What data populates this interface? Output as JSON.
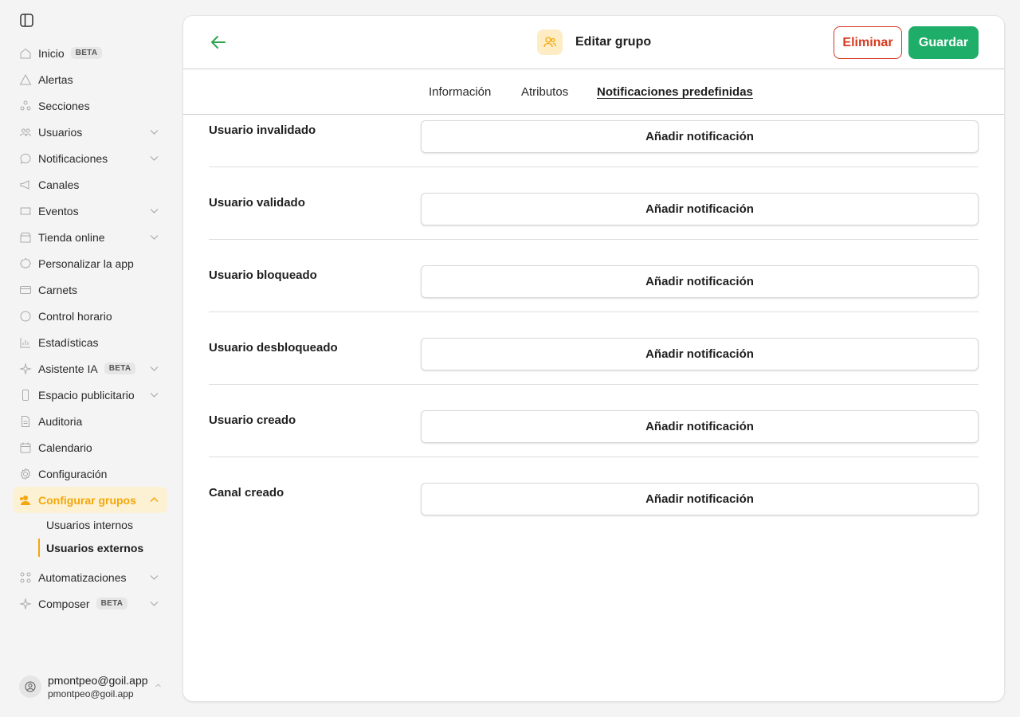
{
  "sidebar": {
    "items": [
      {
        "label": "Inicio",
        "icon": "home-icon",
        "badge": "BETA",
        "chevron": false
      },
      {
        "label": "Alertas",
        "icon": "alert-icon",
        "chevron": false
      },
      {
        "label": "Secciones",
        "icon": "sections-icon",
        "chevron": false
      },
      {
        "label": "Usuarios",
        "icon": "users-icon",
        "chevron": true
      },
      {
        "label": "Notificaciones",
        "icon": "chat-icon",
        "chevron": true
      },
      {
        "label": "Canales",
        "icon": "megaphone-icon",
        "chevron": false
      },
      {
        "label": "Eventos",
        "icon": "ticket-icon",
        "chevron": true
      },
      {
        "label": "Tienda online",
        "icon": "store-icon",
        "chevron": true
      },
      {
        "label": "Personalizar la app",
        "icon": "badge-icon",
        "chevron": false
      },
      {
        "label": "Carnets",
        "icon": "card-icon",
        "chevron": false
      },
      {
        "label": "Control horario",
        "icon": "clock-icon",
        "chevron": false
      },
      {
        "label": "Estadísticas",
        "icon": "chart-icon",
        "chevron": false
      },
      {
        "label": "Asistente IA",
        "icon": "sparkle-icon",
        "badge": "BETA",
        "chevron": true
      },
      {
        "label": "Espacio publicitario",
        "icon": "phone-icon",
        "chevron": true
      },
      {
        "label": "Auditoria",
        "icon": "document-icon",
        "chevron": false
      },
      {
        "label": "Calendario",
        "icon": "calendar-icon",
        "chevron": false
      },
      {
        "label": "Configuración",
        "icon": "gear-icon",
        "chevron": false
      }
    ],
    "active_group": {
      "label": "Configurar grupos",
      "icon": "group-icon",
      "children": [
        {
          "label": "Usuarios internos",
          "active": false
        },
        {
          "label": "Usuarios externos",
          "active": true
        }
      ]
    },
    "after_items": [
      {
        "label": "Automatizaciones",
        "icon": "nodes-icon",
        "badge": "",
        "chevron": true
      },
      {
        "label": "Composer",
        "icon": "sparkle-icon",
        "badge": "BETA",
        "chevron": true
      }
    ],
    "user": {
      "name": "pmontpeo@goil.app",
      "email": "pmontpeo@goil.app"
    }
  },
  "header": {
    "title": "Editar grupo",
    "delete_label": "Eliminar",
    "save_label": "Guardar"
  },
  "tabs": [
    {
      "label": "Información",
      "active": false
    },
    {
      "label": "Atributos",
      "active": false
    },
    {
      "label": "Notificaciones predefinidas",
      "active": true
    }
  ],
  "notifications": [
    {
      "label": "Usuario invalidado",
      "button": "Añadir notificación"
    },
    {
      "label": "Usuario validado",
      "button": "Añadir notificación"
    },
    {
      "label": "Usuario bloqueado",
      "button": "Añadir notificación"
    },
    {
      "label": "Usuario desbloqueado",
      "button": "Añadir notificación"
    },
    {
      "label": "Usuario creado",
      "button": "Añadir notificación"
    },
    {
      "label": "Canal creado",
      "button": "Añadir notificación"
    }
  ],
  "colors": {
    "accent": "#f3a70c",
    "save": "#1fae6a",
    "danger": "#d63a1f",
    "back_arrow": "#2fa54f"
  }
}
